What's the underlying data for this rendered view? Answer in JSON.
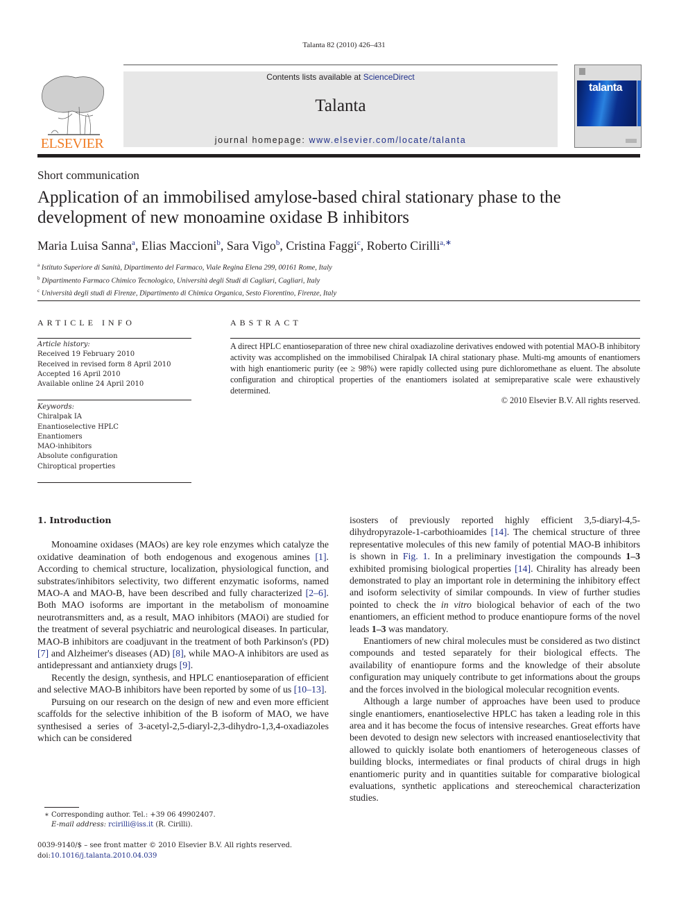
{
  "running_head": "Talanta 82 (2010) 426–431",
  "masthead": {
    "publisher_logo_text": "ELSEVIER",
    "contents_prefix": "Contents lists available at ",
    "contents_link": "ScienceDirect",
    "journal_name": "Talanta",
    "homepage_prefix": "journal homepage: ",
    "homepage_link": "www.elsevier.com/locate/talanta",
    "cover_title": "talanta"
  },
  "article": {
    "type": "Short communication",
    "title": "Application of an immobilised amylose-based chiral stationary phase to the development of new monoamine oxidase B inhibitors",
    "authors": [
      {
        "name": "Maria Luisa Sanna",
        "sup": "a"
      },
      {
        "name": "Elias Maccioni",
        "sup": "b"
      },
      {
        "name": "Sara Vigo",
        "sup": "b"
      },
      {
        "name": "Cristina Faggi",
        "sup": "c"
      },
      {
        "name": "Roberto Cirilli",
        "sup": "a,∗"
      }
    ],
    "affiliations": [
      {
        "key": "a",
        "text": "Istituto Superiore di Sanità, Dipartimento del Farmaco, Viale Regina Elena 299, 00161 Rome, Italy"
      },
      {
        "key": "b",
        "text": "Dipartimento Farmaco Chimico Tecnologico, Università degli Studi di Cagliari, Cagliari, Italy"
      },
      {
        "key": "c",
        "text": "Università degli studi di Firenze, Dipartimento di Chimica Organica, Sesto Fiorentino, Firenze, Italy"
      }
    ]
  },
  "article_info": {
    "label": "ARTICLE INFO",
    "history_head": "Article history:",
    "history": [
      "Received 19 February 2010",
      "Received in revised form 8 April 2010",
      "Accepted 16 April 2010",
      "Available online 24 April 2010"
    ],
    "keywords_head": "Keywords:",
    "keywords": [
      "Chiralpak IA",
      "Enantioselective HPLC",
      "Enantiomers",
      "MAO-inhibitors",
      "Absolute configuration",
      "Chiroptical properties"
    ]
  },
  "abstract": {
    "label": "ABSTRACT",
    "text": "A direct HPLC enantioseparation of three new chiral oxadiazoline derivatives endowed with potential MAO-B inhibitory activity was accomplished on the immobilised Chiralpak IA chiral stationary phase. Multi-mg amounts of enantiomers with high enantiomeric purity (ee ≥ 98%) were rapidly collected using pure dichloromethane as eluent. The absolute configuration and chiroptical properties of the enantiomers isolated at semipreparative scale were exhaustively determined.",
    "copyright": "© 2010 Elsevier B.V. All rights reserved."
  },
  "body": {
    "intro_heading": "1.  Introduction",
    "p1": {
      "a": "Monoamine oxidases (MAOs) are key role enzymes which catalyze the oxidative deamination of both endogenous and exogenous amines ",
      "c1": "[1]",
      "b": ". According to chemical structure, localization, physiological function, and substrates/inhibitors selectivity, two different enzymatic isoforms, named MAO-A and MAO-B, have been described and fully characterized ",
      "c2": "[2–6]",
      "c": ". Both MAO isoforms are important in the metabolism of monoamine neurotransmitters and, as a result, MAO inhibitors (MAOi) are studied for the treatment of several psychiatric and neurological diseases. In particular, MAO-B inhibitors are coadjuvant in the treatment of both Parkinson's (PD) ",
      "c3": "[7]",
      "d": " and Alzheimer's diseases (AD) ",
      "c4": "[8]",
      "e": ", while MAO-A inhibitors are used as antidepressant and antianxiety drugs ",
      "c5": "[9]",
      "f": "."
    },
    "p2": {
      "a": "Recently the design, synthesis, and HPLC enantioseparation of efficient and selective MAO-B inhibitors have been reported by some of us ",
      "c1": "[10–13]",
      "b": "."
    },
    "p3": {
      "a": "Pursuing on our research on the design of new and even more efficient scaffolds for the selective inhibition of the B isoform of MAO, we have synthesised a series of 3-acetyl-2,5-diaryl-2,3-dihydro-1,3,4-oxadiazoles which can be considered isosters of previously reported highly efficient 3,5-diaryl-4,5-dihydropyrazole-1-carbothioamides ",
      "c1": "[14]",
      "b": ". The chemical structure of three representative molecules of this new family of potential MAO-B inhibitors is shown in ",
      "fig": "Fig. 1",
      "c": ". In a preliminary investigation the compounds ",
      "bold1": "1–3",
      "d": " exhibited promising biological properties ",
      "c2": "[14]",
      "e": ". Chirality has already been demonstrated to play an important role in determining the inhibitory effect and isoform selectivity of similar compounds. In view of further studies pointed to check the ",
      "ital": "in vitro",
      "f": " biological behavior of each of the two enantiomers, an efficient method to produce enantiopure forms of the novel leads ",
      "bold2": "1–3",
      "g": " was mandatory."
    },
    "p4": "Enantiomers of new chiral molecules must be considered as two distinct compounds and tested separately for their biological effects. The availability of enantiopure forms and the knowledge of their absolute configuration may uniquely contribute to get informations about the groups and the forces involved in the biological molecular recognition events.",
    "p5": "Although a large number of approaches have been used to produce single enantiomers, enantioselective HPLC has taken a leading role in this area and it has become the focus of intensive researches. Great efforts have been devoted to design new selectors with increased enantioselectivity that allowed to quickly isolate both enantiomers of heterogeneous classes of building blocks, intermediates or final products of chiral drugs in high enantiomeric purity and in quantities suitable for comparative biological evaluations, synthetic applications and stereochemical characterization studies."
  },
  "footnote": {
    "marker": "∗",
    "corresponding": " Corresponding author. Tel.: +39 06 49902407.",
    "email_label": "E-mail address: ",
    "email": "rcirilli@iss.it",
    "email_suffix": " (R. Cirilli)."
  },
  "front_matter": {
    "issn_line": "0039-9140/$ – see front matter © 2010 Elsevier B.V. All rights reserved.",
    "doi_prefix": "doi:",
    "doi": "10.1016/j.talanta.2010.04.039"
  },
  "colors": {
    "link": "#1f2f8a",
    "elsevier_orange": "#f07b22",
    "masthead_bg": "#e7e7e7",
    "text": "#231f20"
  }
}
